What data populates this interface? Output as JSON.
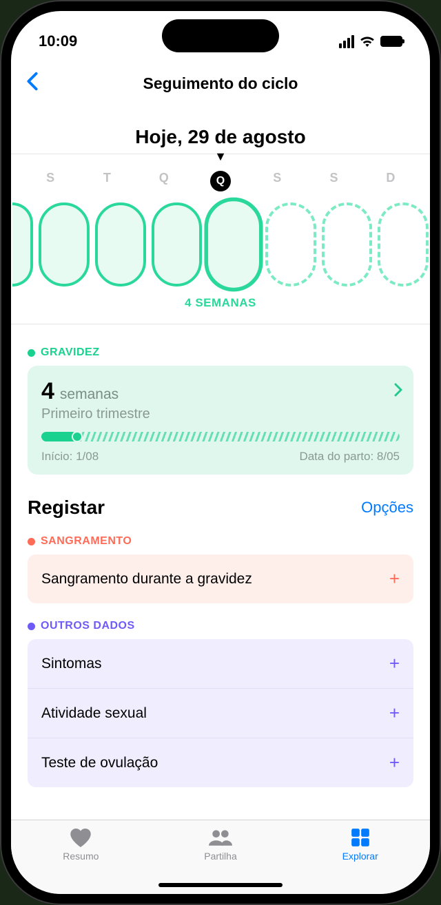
{
  "status": {
    "time": "10:09"
  },
  "nav": {
    "title": "Seguimento do ciclo"
  },
  "date": {
    "heading": "Hoje, 29 de agosto"
  },
  "weekdays": [
    "S",
    "T",
    "Q",
    "Q",
    "S",
    "S",
    "D"
  ],
  "weeks_caption": "4 SEMANAS",
  "pregnancy": {
    "section": "GRAVIDEZ",
    "value": "4",
    "unit": "semanas",
    "trimester": "Primeiro trimestre",
    "start_label": "Início: 1/08",
    "due_label": "Data do parto: 8/05"
  },
  "log": {
    "title": "Registar",
    "options": "Opções"
  },
  "bleeding": {
    "section": "SANGRAMENTO",
    "row": "Sangramento durante a gravidez"
  },
  "other": {
    "section": "OUTROS DADOS",
    "rows": [
      "Sintomas",
      "Atividade sexual",
      "Teste de ovulação"
    ]
  },
  "tabs": {
    "summary": "Resumo",
    "sharing": "Partilha",
    "explore": "Explorar"
  }
}
